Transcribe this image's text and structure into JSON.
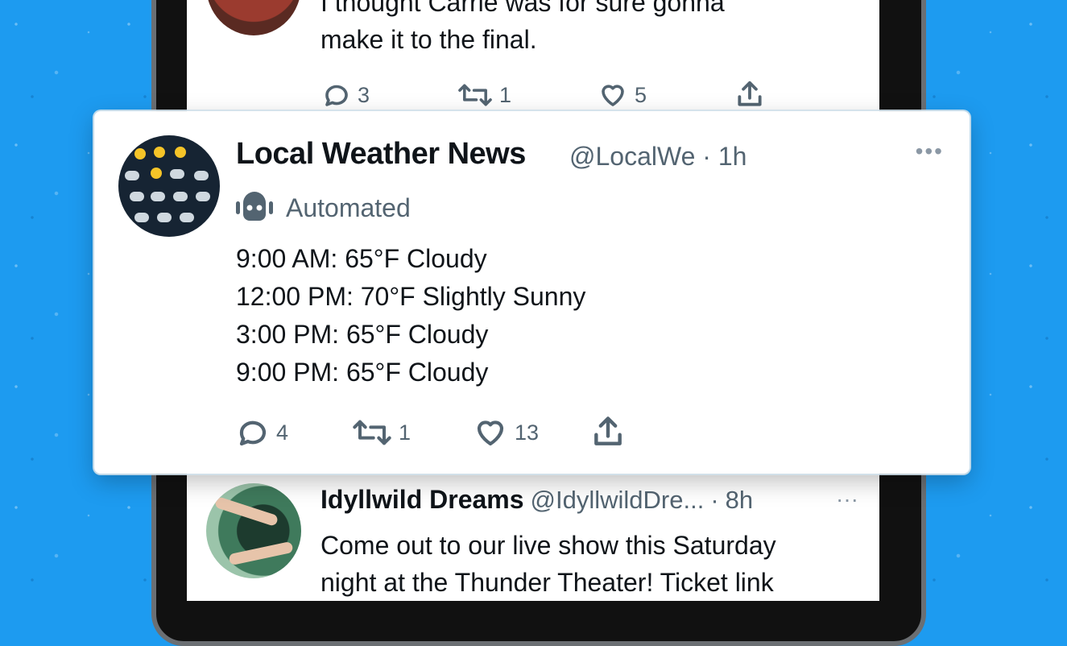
{
  "top_tweet": {
    "text_line1": "I thought Carrie was for sure gonna",
    "text_line2": "make it to the final.",
    "replies": "3",
    "retweets": "1",
    "likes": "5"
  },
  "featured_tweet": {
    "name": "Local Weather News",
    "handle": "@LocalWe",
    "separator": "·",
    "time": "1h",
    "more": "•••",
    "label": "Automated",
    "lines": [
      "9:00 AM: 65°F Cloudy",
      "12:00 PM: 70°F Slightly Sunny",
      "3:00 PM: 65°F Cloudy",
      "9:00 PM: 65°F Cloudy"
    ],
    "replies": "4",
    "retweets": "1",
    "likes": "13"
  },
  "bottom_tweet": {
    "name": "Idyllwild Dreams",
    "handle": "@IdyllwildDre...",
    "separator": "·",
    "time": "8h",
    "more": "···",
    "text_line1": "Come out to our live show this Saturday",
    "text_line2": "night at the Thunder Theater! Ticket link"
  },
  "icons": {
    "reply": "reply-icon",
    "retweet": "retweet-icon",
    "like": "heart-icon",
    "share": "share-icon",
    "bot": "robot-icon"
  },
  "colors": {
    "background": "#1d9bf0",
    "text": "#0f1419",
    "secondary": "#536471"
  }
}
